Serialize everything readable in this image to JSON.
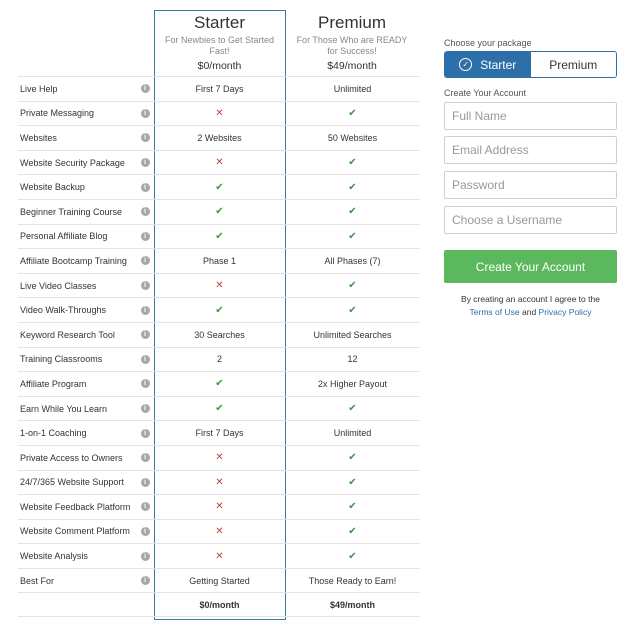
{
  "plans": {
    "starter": {
      "name": "Starter",
      "tagline": "For Newbies to Get Started Fast!",
      "price": "$0/month"
    },
    "premium": {
      "name": "Premium",
      "tagline": "For Those Who are READY for Success!",
      "price": "$49/month"
    }
  },
  "icons": {
    "info": "i",
    "check": "✔",
    "cross": "✕"
  },
  "features": [
    {
      "label": "Live Help",
      "starter": "First 7 Days",
      "premium": "Unlimited"
    },
    {
      "label": "Private Messaging",
      "starter": "✕",
      "premium": "✔"
    },
    {
      "label": "Websites",
      "starter": "2 Websites",
      "premium": "50 Websites"
    },
    {
      "label": "Website Security Package",
      "starter": "✕",
      "premium": "✔"
    },
    {
      "label": "Website Backup",
      "starter": "✔",
      "premium": "✔"
    },
    {
      "label": "Beginner Training Course",
      "starter": "✔",
      "premium": "✔"
    },
    {
      "label": "Personal Affiliate Blog",
      "starter": "✔",
      "premium": "✔"
    },
    {
      "label": "Affiliate Bootcamp Training",
      "starter": "Phase 1",
      "premium": "All Phases (7)"
    },
    {
      "label": "Live Video Classes",
      "starter": "✕",
      "premium": "✔"
    },
    {
      "label": "Video Walk-Throughs",
      "starter": "✔",
      "premium": "✔"
    },
    {
      "label": "Keyword Research Tool",
      "starter": "30 Searches",
      "premium": "Unlimited Searches"
    },
    {
      "label": "Training Classrooms",
      "starter": "2",
      "premium": "12"
    },
    {
      "label": "Affiliate Program",
      "starter": "✔",
      "premium": "2x Higher Payout"
    },
    {
      "label": "Earn While You Learn",
      "starter": "✔",
      "premium": "✔"
    },
    {
      "label": "1-on-1 Coaching",
      "starter": "First 7 Days",
      "premium": "Unlimited"
    },
    {
      "label": "Private Access to Owners",
      "starter": "✕",
      "premium": "✔"
    },
    {
      "label": "24/7/365 Website Support",
      "starter": "✕",
      "premium": "✔"
    },
    {
      "label": "Website Feedback Platform",
      "starter": "✕",
      "premium": "✔"
    },
    {
      "label": "Website Comment Platform",
      "starter": "✕",
      "premium": "✔"
    },
    {
      "label": "Website Analysis",
      "starter": "✕",
      "premium": "✔"
    },
    {
      "label": "Best For",
      "starter": "Getting Started",
      "premium": "Those Ready to Earn!"
    }
  ],
  "totals": {
    "starter": "$0/month",
    "premium": "$49/month"
  },
  "signup": {
    "choose_label": "Choose your package",
    "options": [
      "Starter",
      "Premium"
    ],
    "selected": "Starter",
    "create_label": "Create Your Account",
    "fields": {
      "full_name": {
        "placeholder": "Full Name",
        "value": ""
      },
      "email": {
        "placeholder": "Email Address",
        "value": ""
      },
      "password": {
        "placeholder": "Password",
        "value": ""
      },
      "username": {
        "placeholder": "Choose a Username",
        "value": ""
      }
    },
    "cta_label": "Create Your Account",
    "terms_prefix": "By creating an account I agree to the",
    "terms_link": "Terms of Use",
    "terms_and": "and",
    "privacy_link": "Privacy Policy"
  },
  "colors": {
    "accent": "#2d6fa8",
    "cta": "#5cb85c",
    "check": "#3a9b3a",
    "cross": "#c0453f",
    "starter_outline": "#3e7d9a"
  }
}
